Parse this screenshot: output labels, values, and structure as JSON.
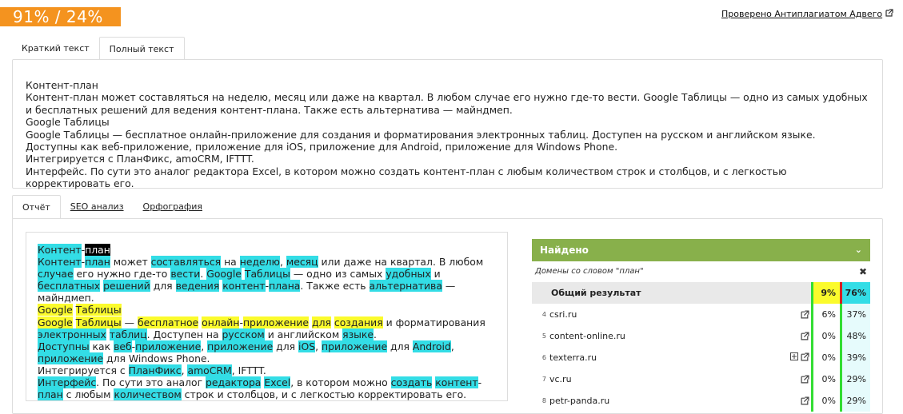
{
  "score": "91% / 24%",
  "checked_link": "Проверено Антиплагиатом Адвего",
  "top_tabs": [
    "Краткий текст",
    "Полный текст"
  ],
  "full_text": [
    "Контент-план",
    "Контент-план может составляться на неделю, месяц или даже на квартал. В любом случае его нужно где-то вести. Google Таблицы — одно из самых удобных и бесплатных решений для ведения контент-плана. Также есть альтернатива — майндмеп.",
    "Google Таблицы",
    "Google Таблицы — бесплатное онлайн-приложение для создания и форматирования электронных таблиц. Доступен на русском и английском языке.",
    "Доступны как веб-приложение, приложение для iOS, приложение для Android, приложение для Windows Phone.",
    "Интегрируется с ПланФикс, amoCRM, IFTTT.",
    "Интерфейс. По сути это аналог редактора Excel, в котором можно создать контент-план с любым количеством строк и столбцов, и с легкостью корректировать его."
  ],
  "bottom_tabs": [
    "Отчёт",
    "SEO анализ",
    "Орфография"
  ],
  "found": {
    "title": "Найдено",
    "domains_label": "Домены со словом \"план\"",
    "total_label": "Общий результат",
    "total_p1": "9%",
    "total_p2": "76%",
    "rows": [
      {
        "num": "4",
        "domain": "csri.ru",
        "p1": "6%",
        "p2": "37%"
      },
      {
        "num": "5",
        "domain": "content-online.ru",
        "p1": "0%",
        "p2": "48%"
      },
      {
        "num": "6",
        "domain": "texterra.ru",
        "p1": "0%",
        "p2": "39%"
      },
      {
        "num": "7",
        "domain": "vc.ru",
        "p1": "0%",
        "p2": "29%"
      },
      {
        "num": "8",
        "domain": "petr-panda.ru",
        "p1": "0%",
        "p2": "29%"
      }
    ]
  },
  "colors": {
    "score_bg": "#f4931f",
    "found_header": "#88b04b",
    "cyan_highlight": "#33dde6",
    "yellow_highlight": "#fbfb2c"
  }
}
